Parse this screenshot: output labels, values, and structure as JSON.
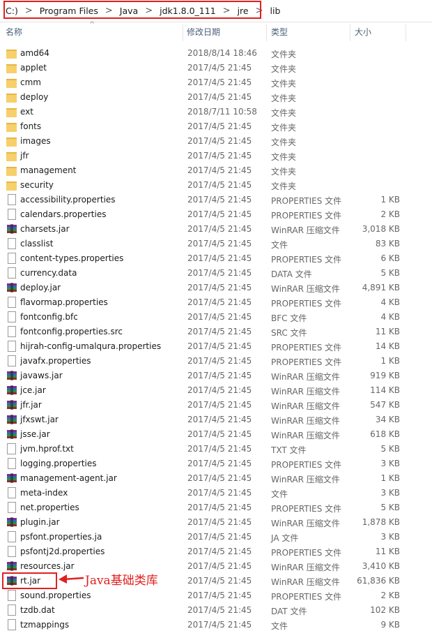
{
  "breadcrumb": [
    "C:)",
    "Program Files",
    "Java",
    "jdk1.8.0_111",
    "jre",
    "lib"
  ],
  "columns": {
    "name": "名称",
    "date": "修改日期",
    "type": "类型",
    "size": "大小"
  },
  "files": [
    {
      "name": "amd64",
      "date": "2018/8/14 18:46",
      "type": "文件夹",
      "size": "",
      "icon": "folder"
    },
    {
      "name": "applet",
      "date": "2017/4/5 21:45",
      "type": "文件夹",
      "size": "",
      "icon": "folder"
    },
    {
      "name": "cmm",
      "date": "2017/4/5 21:45",
      "type": "文件夹",
      "size": "",
      "icon": "folder"
    },
    {
      "name": "deploy",
      "date": "2017/4/5 21:45",
      "type": "文件夹",
      "size": "",
      "icon": "folder"
    },
    {
      "name": "ext",
      "date": "2018/7/11 10:58",
      "type": "文件夹",
      "size": "",
      "icon": "folder"
    },
    {
      "name": "fonts",
      "date": "2017/4/5 21:45",
      "type": "文件夹",
      "size": "",
      "icon": "folder"
    },
    {
      "name": "images",
      "date": "2017/4/5 21:45",
      "type": "文件夹",
      "size": "",
      "icon": "folder"
    },
    {
      "name": "jfr",
      "date": "2017/4/5 21:45",
      "type": "文件夹",
      "size": "",
      "icon": "folder"
    },
    {
      "name": "management",
      "date": "2017/4/5 21:45",
      "type": "文件夹",
      "size": "",
      "icon": "folder"
    },
    {
      "name": "security",
      "date": "2017/4/5 21:45",
      "type": "文件夹",
      "size": "",
      "icon": "folder"
    },
    {
      "name": "accessibility.properties",
      "date": "2017/4/5 21:45",
      "type": "PROPERTIES 文件",
      "size": "1 KB",
      "icon": "doc"
    },
    {
      "name": "calendars.properties",
      "date": "2017/4/5 21:45",
      "type": "PROPERTIES 文件",
      "size": "2 KB",
      "icon": "doc"
    },
    {
      "name": "charsets.jar",
      "date": "2017/4/5 21:45",
      "type": "WinRAR 压缩文件",
      "size": "3,018 KB",
      "icon": "jar"
    },
    {
      "name": "classlist",
      "date": "2017/4/5 21:45",
      "type": "文件",
      "size": "83 KB",
      "icon": "doc"
    },
    {
      "name": "content-types.properties",
      "date": "2017/4/5 21:45",
      "type": "PROPERTIES 文件",
      "size": "6 KB",
      "icon": "doc"
    },
    {
      "name": "currency.data",
      "date": "2017/4/5 21:45",
      "type": "DATA 文件",
      "size": "5 KB",
      "icon": "doc"
    },
    {
      "name": "deploy.jar",
      "date": "2017/4/5 21:45",
      "type": "WinRAR 压缩文件",
      "size": "4,891 KB",
      "icon": "jar"
    },
    {
      "name": "flavormap.properties",
      "date": "2017/4/5 21:45",
      "type": "PROPERTIES 文件",
      "size": "4 KB",
      "icon": "doc"
    },
    {
      "name": "fontconfig.bfc",
      "date": "2017/4/5 21:45",
      "type": "BFC 文件",
      "size": "4 KB",
      "icon": "doc"
    },
    {
      "name": "fontconfig.properties.src",
      "date": "2017/4/5 21:45",
      "type": "SRC 文件",
      "size": "11 KB",
      "icon": "doc"
    },
    {
      "name": "hijrah-config-umalqura.properties",
      "date": "2017/4/5 21:45",
      "type": "PROPERTIES 文件",
      "size": "14 KB",
      "icon": "doc"
    },
    {
      "name": "javafx.properties",
      "date": "2017/4/5 21:45",
      "type": "PROPERTIES 文件",
      "size": "1 KB",
      "icon": "doc"
    },
    {
      "name": "javaws.jar",
      "date": "2017/4/5 21:45",
      "type": "WinRAR 压缩文件",
      "size": "919 KB",
      "icon": "jar"
    },
    {
      "name": "jce.jar",
      "date": "2017/4/5 21:45",
      "type": "WinRAR 压缩文件",
      "size": "114 KB",
      "icon": "jar"
    },
    {
      "name": "jfr.jar",
      "date": "2017/4/5 21:45",
      "type": "WinRAR 压缩文件",
      "size": "547 KB",
      "icon": "jar"
    },
    {
      "name": "jfxswt.jar",
      "date": "2017/4/5 21:45",
      "type": "WinRAR 压缩文件",
      "size": "34 KB",
      "icon": "jar"
    },
    {
      "name": "jsse.jar",
      "date": "2017/4/5 21:45",
      "type": "WinRAR 压缩文件",
      "size": "618 KB",
      "icon": "jar"
    },
    {
      "name": "jvm.hprof.txt",
      "date": "2017/4/5 21:45",
      "type": "TXT 文件",
      "size": "5 KB",
      "icon": "txt"
    },
    {
      "name": "logging.properties",
      "date": "2017/4/5 21:45",
      "type": "PROPERTIES 文件",
      "size": "3 KB",
      "icon": "doc"
    },
    {
      "name": "management-agent.jar",
      "date": "2017/4/5 21:45",
      "type": "WinRAR 压缩文件",
      "size": "1 KB",
      "icon": "jar"
    },
    {
      "name": "meta-index",
      "date": "2017/4/5 21:45",
      "type": "文件",
      "size": "3 KB",
      "icon": "doc"
    },
    {
      "name": "net.properties",
      "date": "2017/4/5 21:45",
      "type": "PROPERTIES 文件",
      "size": "5 KB",
      "icon": "doc"
    },
    {
      "name": "plugin.jar",
      "date": "2017/4/5 21:45",
      "type": "WinRAR 压缩文件",
      "size": "1,878 KB",
      "icon": "jar"
    },
    {
      "name": "psfont.properties.ja",
      "date": "2017/4/5 21:45",
      "type": "JA 文件",
      "size": "3 KB",
      "icon": "doc"
    },
    {
      "name": "psfontj2d.properties",
      "date": "2017/4/5 21:45",
      "type": "PROPERTIES 文件",
      "size": "11 KB",
      "icon": "doc"
    },
    {
      "name": "resources.jar",
      "date": "2017/4/5 21:45",
      "type": "WinRAR 压缩文件",
      "size": "3,410 KB",
      "icon": "jar"
    },
    {
      "name": "rt.jar",
      "date": "2017/4/5 21:45",
      "type": "WinRAR 压缩文件",
      "size": "61,836 KB",
      "icon": "jar"
    },
    {
      "name": "sound.properties",
      "date": "2017/4/5 21:45",
      "type": "PROPERTIES 文件",
      "size": "2 KB",
      "icon": "doc"
    },
    {
      "name": "tzdb.dat",
      "date": "2017/4/5 21:45",
      "type": "DAT 文件",
      "size": "102 KB",
      "icon": "doc"
    },
    {
      "name": "tzmappings",
      "date": "2017/4/5 21:45",
      "type": "文件",
      "size": "9 KB",
      "icon": "doc"
    }
  ],
  "annotation": {
    "text": "Java基础类库",
    "color": "#e02020"
  },
  "colors": {
    "highlight": "#e02020",
    "folder": "#f6d06a",
    "header_text": "#4c607a"
  }
}
